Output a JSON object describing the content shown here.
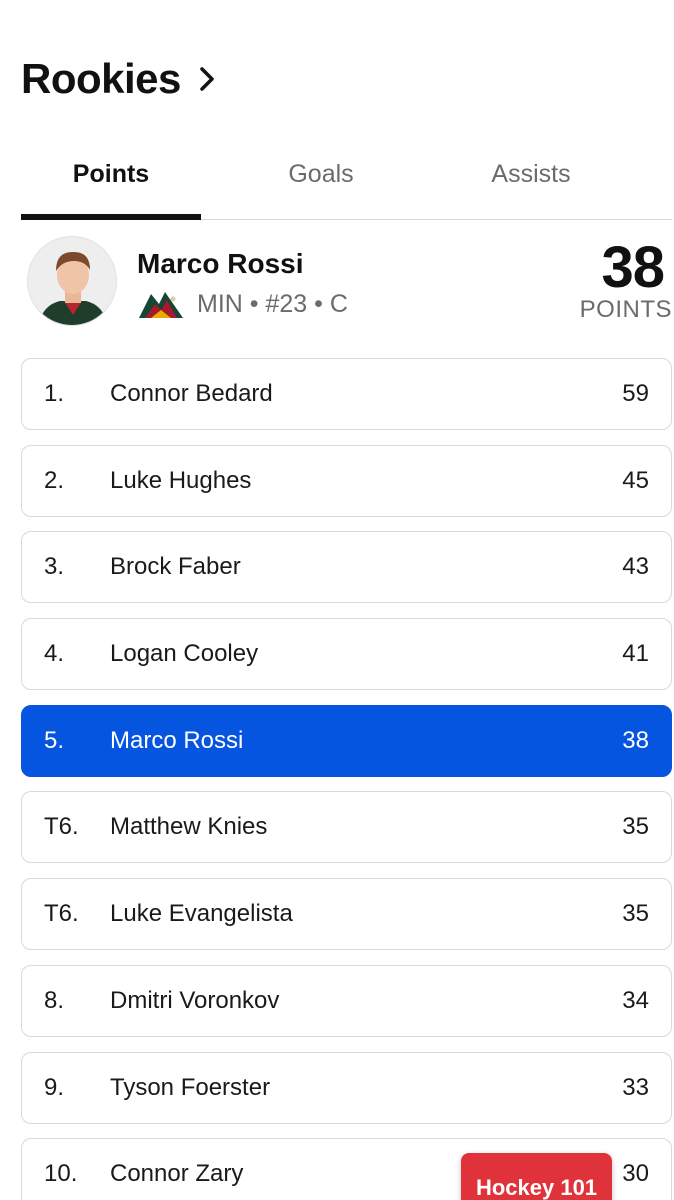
{
  "header": {
    "title": "Rookies",
    "chevron_icon": "chevron-right-icon"
  },
  "tabs": [
    {
      "label": "Points",
      "active": true
    },
    {
      "label": "Goals",
      "active": false
    },
    {
      "label": "Assists",
      "active": false
    }
  ],
  "featured": {
    "name": "Marco Rossi",
    "team": "MIN",
    "number": "#23",
    "position": "C",
    "meta": "MIN • #23 • C",
    "value": "38",
    "unit": "POINTS",
    "avatar_icon": "player-headshot",
    "team_logo_icon": "minnesota-wild-logo"
  },
  "leaders": [
    {
      "rank": "1.",
      "name": "Connor Bedard",
      "points": "59"
    },
    {
      "rank": "2.",
      "name": "Luke Hughes",
      "points": "45"
    },
    {
      "rank": "3.",
      "name": "Brock Faber",
      "points": "43"
    },
    {
      "rank": "4.",
      "name": "Logan Cooley",
      "points": "41"
    },
    {
      "rank": "5.",
      "name": "Marco Rossi",
      "points": "38",
      "highlighted": true
    },
    {
      "rank": "T6.",
      "name": "Matthew Knies",
      "points": "35"
    },
    {
      "rank": "T6.",
      "name": "Luke Evangelista",
      "points": "35"
    },
    {
      "rank": "8.",
      "name": "Dmitri Voronkov",
      "points": "34"
    },
    {
      "rank": "9.",
      "name": "Tyson Foerster",
      "points": "33"
    },
    {
      "rank": "10.",
      "name": "Connor Zary",
      "points": "30"
    }
  ],
  "floating_button": {
    "label": "Hockey 101"
  },
  "colors": {
    "highlight": "#0655e0",
    "fab": "#e0323a",
    "text_primary": "#111111",
    "text_secondary": "#6b6b6b",
    "border": "#d9d9d9"
  }
}
